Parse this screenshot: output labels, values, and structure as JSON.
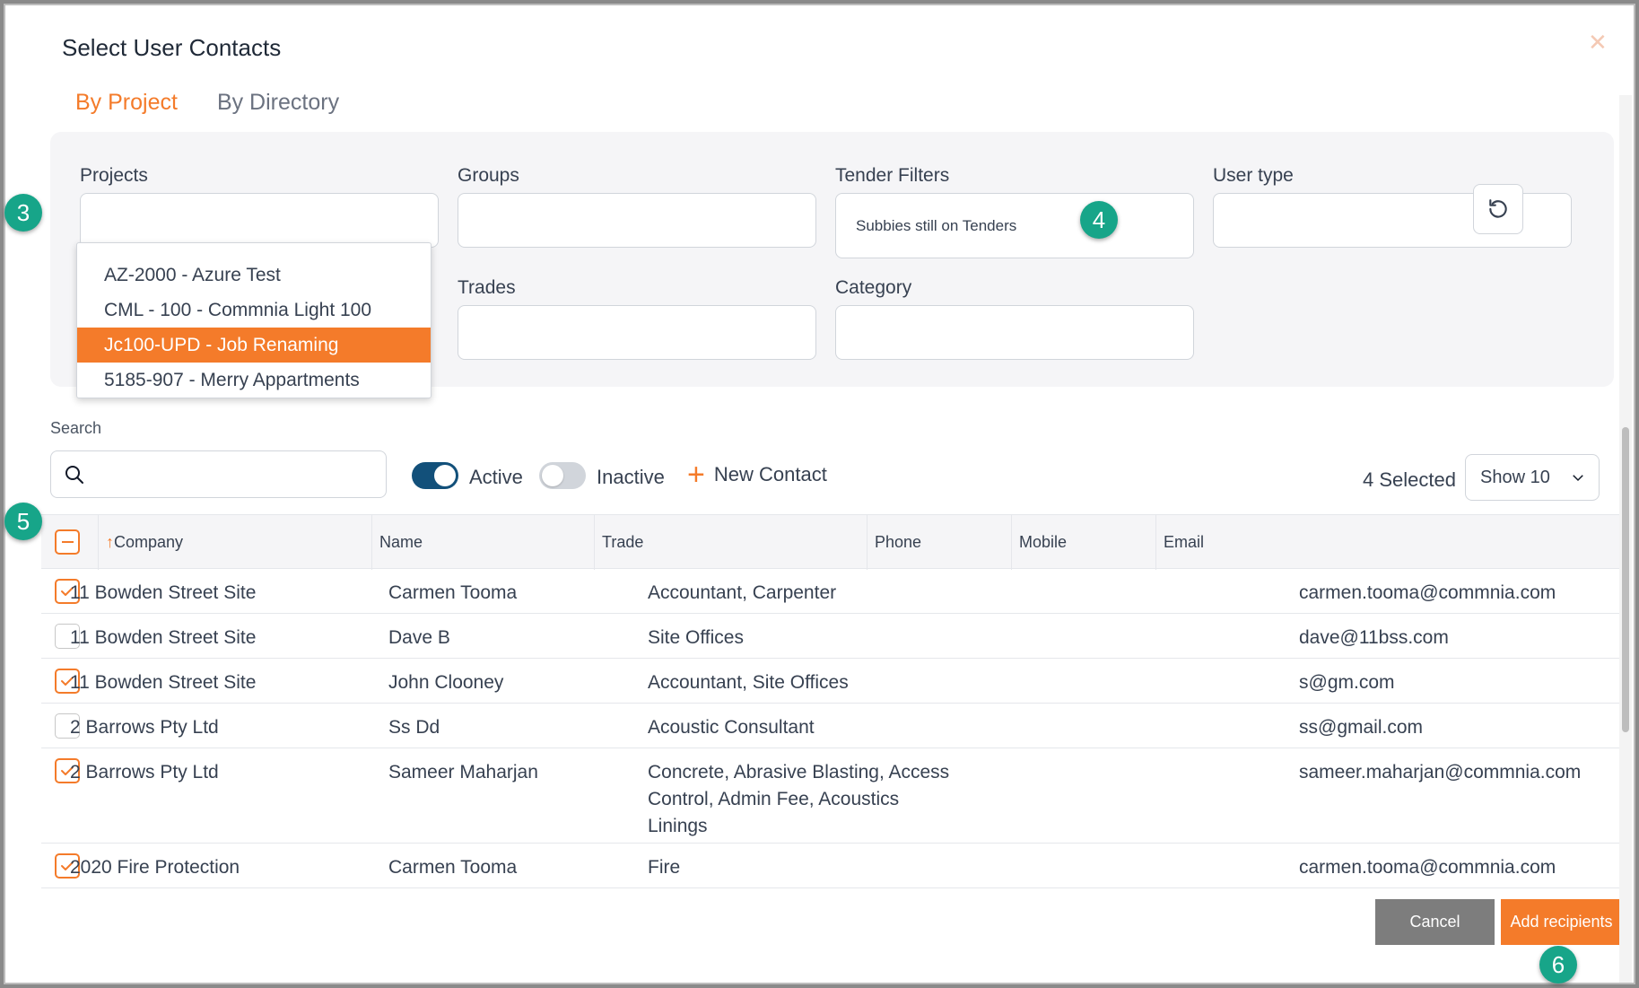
{
  "dialog": {
    "title": "Select User Contacts",
    "close_icon": "close-icon"
  },
  "tabs": [
    {
      "label": "By Project",
      "active": true
    },
    {
      "label": "By Directory",
      "active": false
    }
  ],
  "filters": {
    "projects_label": "Projects",
    "groups_label": "Groups",
    "tender_filters_label": "Tender Filters",
    "tender_filters_value": "Subbies still on Tenders",
    "user_type_label": "User type",
    "trades_label": "Trades",
    "category_label": "Category",
    "reset_icon": "reset-icon"
  },
  "project_dropdown": {
    "options": [
      "AZ-2000 - Azure Test",
      "CML - 100 - Commnia Light 100",
      "Jc100-UPD - Job Renaming",
      "5185-907 - Merry Appartments"
    ],
    "selected": "Jc100-UPD - Job Renaming"
  },
  "search": {
    "label": "Search",
    "value": "",
    "placeholder": ""
  },
  "toggles": {
    "active_label": "Active",
    "active_on": true,
    "inactive_label": "Inactive",
    "inactive_on": false
  },
  "new_contact_label": "New Contact",
  "selected_count": "4 Selected",
  "page_size": "Show 10",
  "table": {
    "columns": [
      "Company",
      "Name",
      "Trade",
      "Phone",
      "Mobile",
      "Email"
    ],
    "sort_indicator": "↑",
    "rows": [
      {
        "checked": true,
        "company": "11 Bowden Street Site",
        "name": "Carmen Tooma",
        "trade_lines": [
          "Accountant, Carpenter"
        ],
        "phone": "",
        "mobile": "",
        "email": "carmen.tooma@commnia.com"
      },
      {
        "checked": false,
        "company": "11 Bowden Street Site",
        "name": "Dave B",
        "trade_lines": [
          "Site Offices"
        ],
        "phone": "",
        "mobile": "",
        "email": "dave@11bss.com"
      },
      {
        "checked": true,
        "company": "11 Bowden Street Site",
        "name": "John Clooney",
        "trade_lines": [
          "Accountant, Site Offices"
        ],
        "phone": "",
        "mobile": "",
        "email": "s@gm.com"
      },
      {
        "checked": false,
        "company": "2 Barrows Pty Ltd",
        "name": "Ss Dd",
        "trade_lines": [
          "Acoustic Consultant"
        ],
        "phone": "",
        "mobile": "",
        "email": "ss@gmail.com"
      },
      {
        "checked": true,
        "company": "2 Barrows Pty Ltd",
        "name": "Sameer Maharjan",
        "trade_lines": [
          "Concrete, Abrasive Blasting, Access",
          "Control, Admin Fee, Acoustics",
          "Linings"
        ],
        "phone": "",
        "mobile": "",
        "email": "sameer.maharjan@commnia.com"
      },
      {
        "checked": true,
        "company": "2020 Fire Protection",
        "name": "Carmen Tooma",
        "trade_lines": [
          "Fire"
        ],
        "phone": "",
        "mobile": "",
        "email": "carmen.tooma@commnia.com"
      }
    ]
  },
  "buttons": {
    "cancel": "Cancel",
    "add_recipients": "Add recipients"
  },
  "badges": [
    "3",
    "4",
    "5",
    "6"
  ],
  "colors": {
    "accent": "#f47b2a",
    "badge": "#17a589",
    "toggle_on": "#12507a",
    "cancel": "#7d7d7d"
  }
}
